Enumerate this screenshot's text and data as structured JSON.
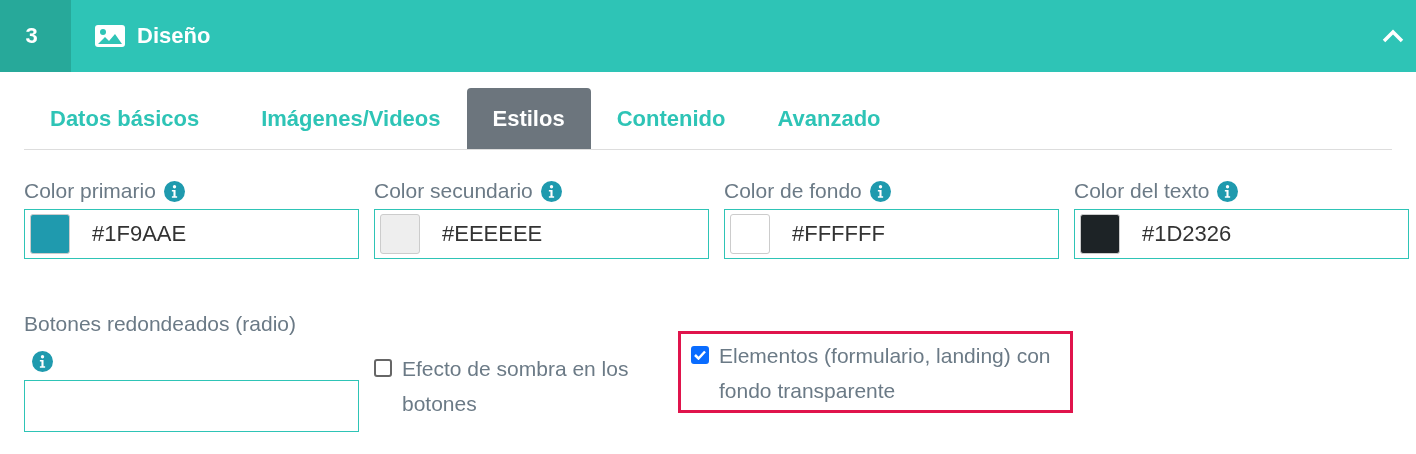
{
  "header": {
    "step": "3",
    "title": "Diseño",
    "expanded": true
  },
  "tabs": [
    {
      "label": "Datos básicos",
      "selected": false
    },
    {
      "label": "Imágenes/Videos",
      "selected": false
    },
    {
      "label": "Estilos",
      "selected": true
    },
    {
      "label": "Contenido",
      "selected": false
    },
    {
      "label": "Avanzado",
      "selected": false
    }
  ],
  "color_fields": [
    {
      "label": "Color primario",
      "value": "#1F9AAE",
      "color": "#1f9aae"
    },
    {
      "label": "Color secundario",
      "value": "#EEEEEE",
      "color": "#eeeeee"
    },
    {
      "label": "Color de fondo",
      "value": "#FFFFFF",
      "color": "#ffffff"
    },
    {
      "label": "Color del texto",
      "value": "#1D2326",
      "color": "#1d2326"
    }
  ],
  "radius_field": {
    "label": "Botones redondeados (radio)"
  },
  "checkboxes": [
    {
      "label": "Efecto de sombra en los botones",
      "checked": false,
      "highlighted": false
    },
    {
      "label": "Elementos (formulario, landing) con fondo transparente",
      "checked": true,
      "highlighted": true
    }
  ]
}
